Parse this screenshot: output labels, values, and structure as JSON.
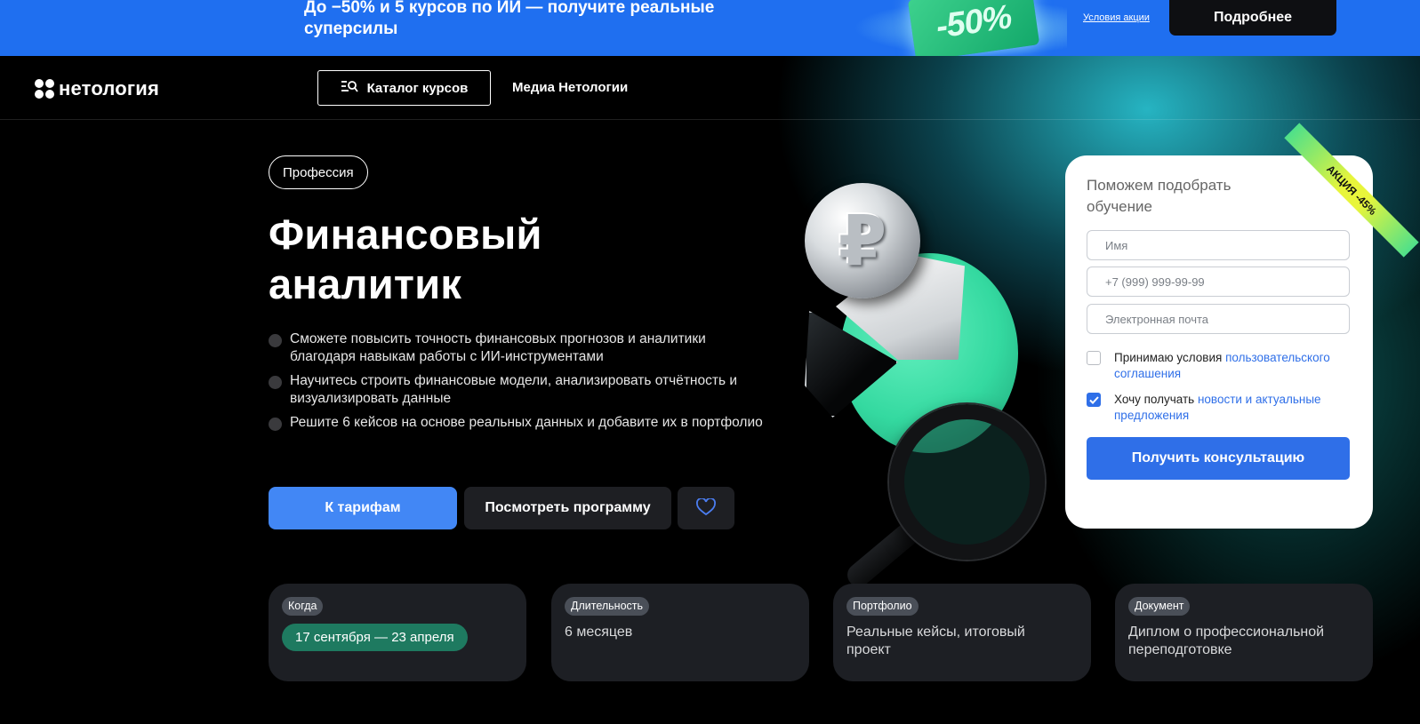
{
  "promo": {
    "text": "До −50% и 5 курсов по ИИ — получите реальные суперсилы",
    "ticket": "-50%",
    "terms": "Условия акции",
    "cta": "Подробнее"
  },
  "header": {
    "logo": "нетология",
    "catalog": "Каталог курсов",
    "media": "Медиа Нетологии"
  },
  "hero": {
    "tag": "Профессия",
    "title_line1": "Финансовый",
    "title_line2": "аналитик",
    "bullets": [
      "Сможете повысить точность финансовых прогнозов и аналитики благодаря навыкам работы с ИИ-инструментами",
      "Научитесь строить финансовые модели, анализировать отчётность и визуализировать данные",
      "Решите 6 кейсов на основе реальных данных и добавите их в портфолио"
    ],
    "btn_tariff": "К тарифам",
    "btn_program": "Посмотреть программу",
    "coin_symbol": "₽"
  },
  "form": {
    "ribbon": "АКЦИЯ -45%",
    "title": "Поможем подобрать обучение",
    "name_placeholder": "Имя",
    "phone_placeholder": "+7 (999) 999-99-99",
    "email_placeholder": "Электронная почта",
    "agree_text": "Принимаю условия ",
    "agree_link": "пользовательского соглашения",
    "agree_checked": false,
    "news_text": "Хочу получать ",
    "news_link": "новости и актуальные предложения",
    "news_checked": true,
    "submit": "Получить консультацию"
  },
  "cards": [
    {
      "badge": "Когда",
      "value": "17 сентября — 23 апреля"
    },
    {
      "badge": "Длительность",
      "value": "6 месяцев"
    },
    {
      "badge": "Портфолио",
      "value": "Реальные кейсы, итоговый проект"
    },
    {
      "badge": "Документ",
      "value": "Диплом о профессиональной переподготовке"
    }
  ],
  "colors": {
    "promo_bg": "#1f6ff0",
    "primary": "#4287f5",
    "form_primary": "#2f6fe8",
    "card_bg": "#1d1f24",
    "pill_green": "#1e7a60"
  },
  "icons": {
    "catalog": "search-list-icon",
    "favorite": "heart-icon",
    "logo": "four-dots-icon"
  }
}
